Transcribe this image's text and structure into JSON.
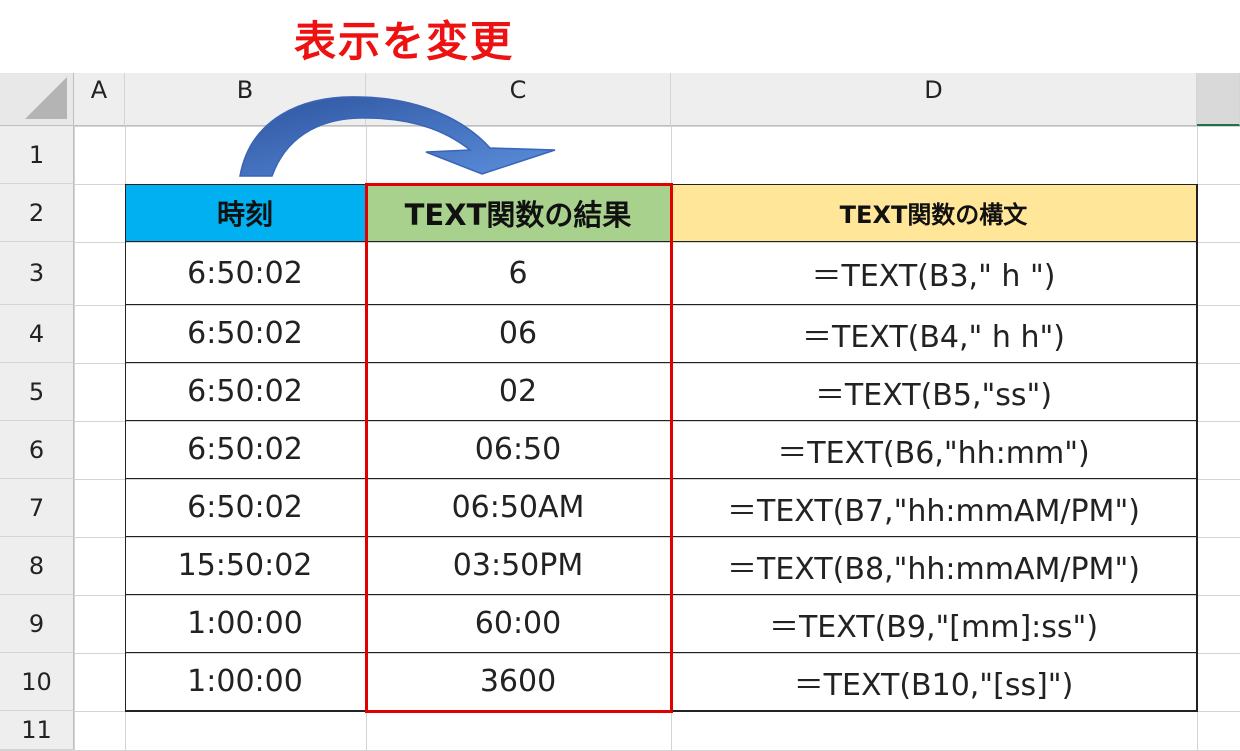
{
  "annotation": {
    "label": "表示を変更"
  },
  "columns": [
    "A",
    "B",
    "C",
    "D"
  ],
  "rows": [
    "1",
    "2",
    "3",
    "4",
    "5",
    "6",
    "7",
    "8",
    "9",
    "10",
    "11"
  ],
  "table": {
    "headers": {
      "time": "時刻",
      "result": "TEXT関数の結果",
      "syntax": "TEXT関数の構文"
    },
    "rows": [
      {
        "time": "6:50:02",
        "result": "6",
        "syntax": "＝TEXT(B3,\" h \")"
      },
      {
        "time": "6:50:02",
        "result": "06",
        "syntax": "＝TEXT(B4,\" h h\")"
      },
      {
        "time": "6:50:02",
        "result": "02",
        "syntax": "＝TEXT(B5,\"ss\")"
      },
      {
        "time": "6:50:02",
        "result": "06:50",
        "syntax": "＝TEXT(B6,\"hh:mm\")"
      },
      {
        "time": "6:50:02",
        "result": "06:50AM",
        "syntax": "＝TEXT(B7,\"hh:mmAM/PM\")"
      },
      {
        "time": "15:50:02",
        "result": "03:50PM",
        "syntax": "＝TEXT(B8,\"hh:mmAM/PM\")"
      },
      {
        "time": "1:00:00",
        "result": "60:00",
        "syntax": "＝TEXT(B9,\"[mm]:ss\")"
      },
      {
        "time": "1:00:00",
        "result": "3600",
        "syntax": "＝TEXT(B10,\"[ss]\")"
      }
    ]
  },
  "colors": {
    "header_time": "#00b0f0",
    "header_result": "#a9d18e",
    "header_syntax": "#ffe699",
    "highlight_border": "#e00000",
    "annotation_text": "#ee1111",
    "arrow_fill": "#4472c4"
  }
}
